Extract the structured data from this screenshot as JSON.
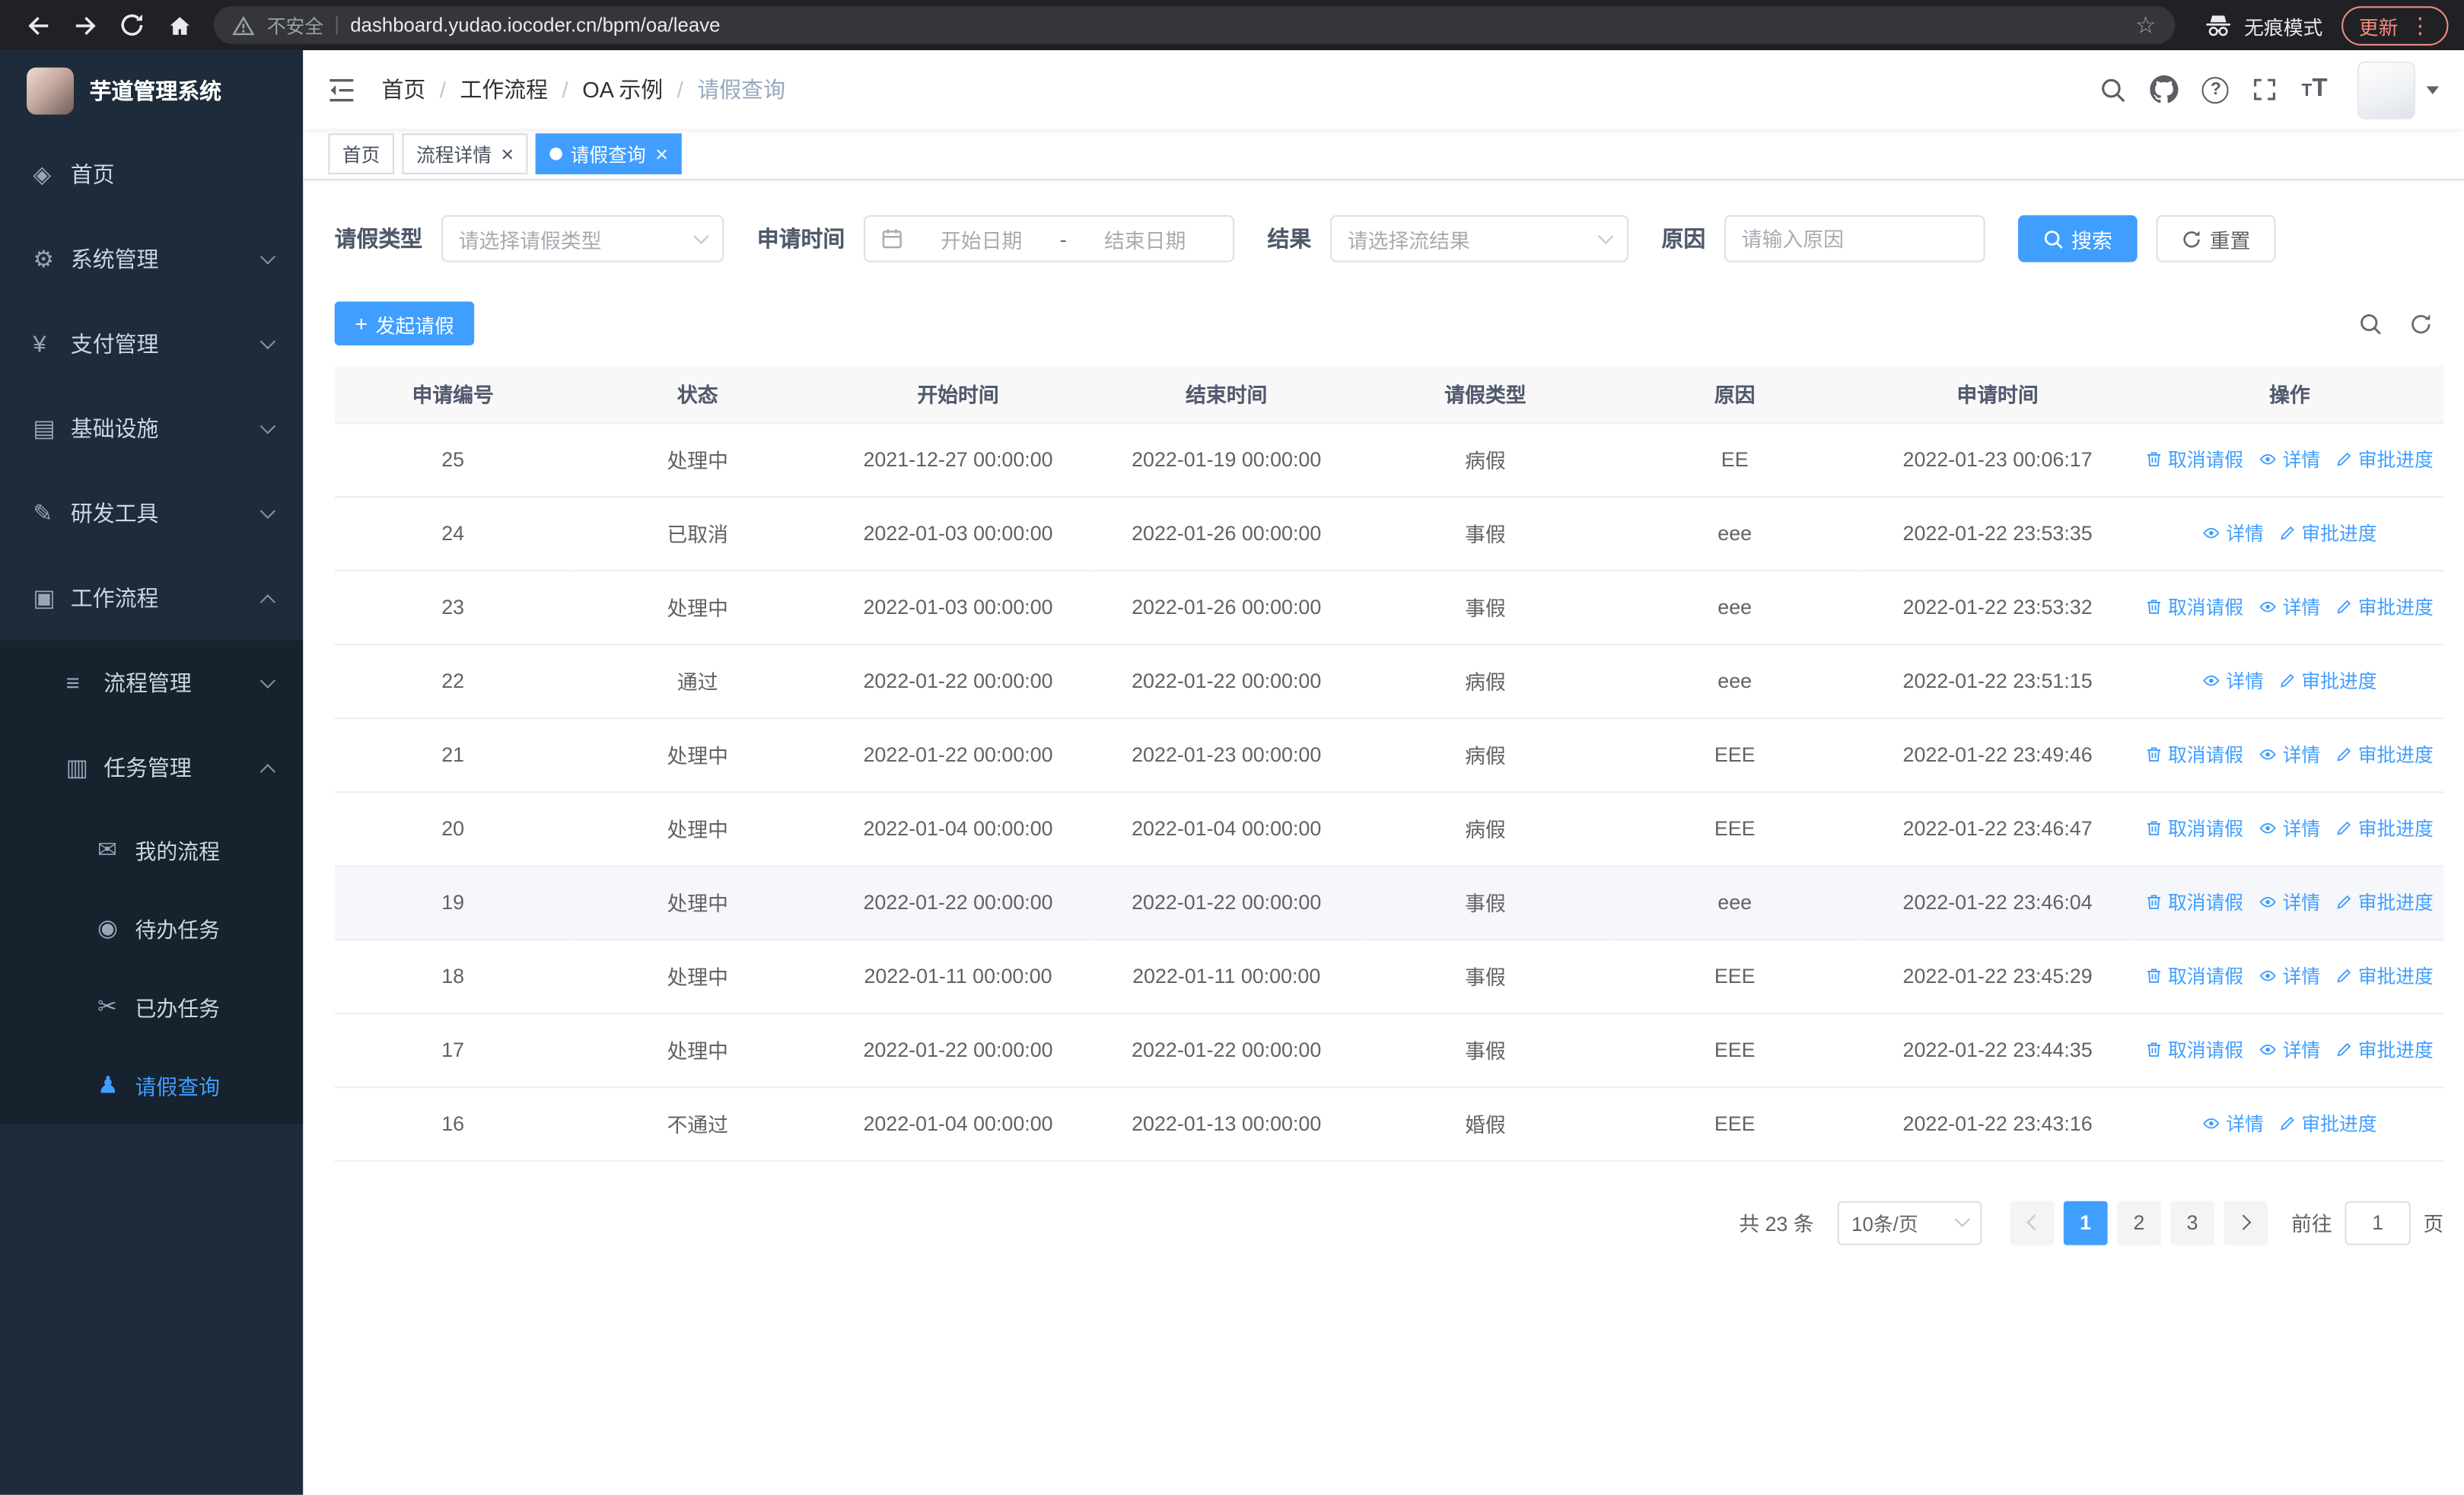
{
  "browser": {
    "security_label": "不安全",
    "url": "dashboard.yudao.iocoder.cn/bpm/oa/leave",
    "incognito_label": "无痕模式",
    "update_label": "更新"
  },
  "sidebar": {
    "logo_title": "芋道管理系统",
    "menu": [
      {
        "name": "home",
        "label": "首页",
        "icon": "home-icon",
        "level": 1,
        "chevron": "",
        "sub": false,
        "active": false
      },
      {
        "name": "system-management",
        "label": "系统管理",
        "icon": "gear-icon",
        "level": 1,
        "chevron": "down",
        "sub": false,
        "active": false
      },
      {
        "name": "payment-management",
        "label": "支付管理",
        "icon": "payment-icon",
        "level": 1,
        "chevron": "down",
        "sub": false,
        "active": false
      },
      {
        "name": "infrastructure",
        "label": "基础设施",
        "icon": "infrastructure-icon",
        "level": 1,
        "chevron": "down",
        "sub": false,
        "active": false
      },
      {
        "name": "devtools",
        "label": "研发工具",
        "icon": "devtools-icon",
        "level": 1,
        "chevron": "down",
        "sub": false,
        "active": false
      },
      {
        "name": "workflow",
        "label": "工作流程",
        "icon": "workflow-icon",
        "level": 1,
        "chevron": "up",
        "sub": false,
        "active": false
      },
      {
        "name": "process-management",
        "label": "流程管理",
        "icon": "process-icon",
        "level": 2,
        "chevron": "down",
        "sub": true,
        "active": false
      },
      {
        "name": "task-management",
        "label": "任务管理",
        "icon": "task-icon",
        "level": 2,
        "chevron": "up",
        "sub": true,
        "active": false
      },
      {
        "name": "my-process",
        "label": "我的流程",
        "icon": "my-process-icon",
        "level": 3,
        "chevron": "",
        "sub": true,
        "active": false
      },
      {
        "name": "todo-tasks",
        "label": "待办任务",
        "icon": "todo-icon",
        "level": 3,
        "chevron": "",
        "sub": true,
        "active": false
      },
      {
        "name": "done-tasks",
        "label": "已办任务",
        "icon": "done-icon",
        "level": 3,
        "chevron": "",
        "sub": true,
        "active": false
      },
      {
        "name": "leave-query",
        "label": "请假查询",
        "icon": "leave-query-icon",
        "level": 3,
        "chevron": "",
        "sub": true,
        "active": true
      }
    ]
  },
  "navbar": {
    "breadcrumb": [
      {
        "label": "首页",
        "current": false
      },
      {
        "label": "工作流程",
        "current": false
      },
      {
        "label": "OA 示例",
        "current": false
      },
      {
        "label": "请假查询",
        "current": true
      }
    ]
  },
  "tags": [
    {
      "name": "home",
      "label": "首页",
      "closable": false,
      "active": false
    },
    {
      "name": "process-detail",
      "label": "流程详情",
      "closable": true,
      "active": false
    },
    {
      "name": "leave-query",
      "label": "请假查询",
      "closable": true,
      "active": true
    }
  ],
  "filters": {
    "leave_type": {
      "label": "请假类型",
      "placeholder": "请选择请假类型"
    },
    "apply_time": {
      "label": "申请时间",
      "start_placeholder": "开始日期",
      "separator": "-",
      "end_placeholder": "结束日期"
    },
    "result": {
      "label": "结果",
      "placeholder": "请选择流结果"
    },
    "reason": {
      "label": "原因",
      "placeholder": "请输入原因"
    },
    "search_label": "搜索",
    "reset_label": "重置"
  },
  "toolbar": {
    "create_label": "发起请假"
  },
  "table": {
    "columns": [
      "申请编号",
      "状态",
      "开始时间",
      "结束时间",
      "请假类型",
      "原因",
      "申请时间",
      "操作"
    ],
    "action_labels": {
      "cancel": "取消请假",
      "detail": "详情",
      "progress": "审批进度"
    },
    "rows": [
      {
        "id": "25",
        "status": "处理中",
        "start_time": "2021-12-27 00:00:00",
        "end_time": "2022-01-19 00:00:00",
        "leave_type": "病假",
        "reason": "EE",
        "apply_time": "2022-01-23 00:06:17",
        "cancelable": true,
        "highlight": false
      },
      {
        "id": "24",
        "status": "已取消",
        "start_time": "2022-01-03 00:00:00",
        "end_time": "2022-01-26 00:00:00",
        "leave_type": "事假",
        "reason": "eee",
        "apply_time": "2022-01-22 23:53:35",
        "cancelable": false,
        "highlight": false
      },
      {
        "id": "23",
        "status": "处理中",
        "start_time": "2022-01-03 00:00:00",
        "end_time": "2022-01-26 00:00:00",
        "leave_type": "事假",
        "reason": "eee",
        "apply_time": "2022-01-22 23:53:32",
        "cancelable": true,
        "highlight": false
      },
      {
        "id": "22",
        "status": "通过",
        "start_time": "2022-01-22 00:00:00",
        "end_time": "2022-01-22 00:00:00",
        "leave_type": "病假",
        "reason": "eee",
        "apply_time": "2022-01-22 23:51:15",
        "cancelable": false,
        "highlight": false
      },
      {
        "id": "21",
        "status": "处理中",
        "start_time": "2022-01-22 00:00:00",
        "end_time": "2022-01-23 00:00:00",
        "leave_type": "病假",
        "reason": "EEE",
        "apply_time": "2022-01-22 23:49:46",
        "cancelable": true,
        "highlight": false
      },
      {
        "id": "20",
        "status": "处理中",
        "start_time": "2022-01-04 00:00:00",
        "end_time": "2022-01-04 00:00:00",
        "leave_type": "病假",
        "reason": "EEE",
        "apply_time": "2022-01-22 23:46:47",
        "cancelable": true,
        "highlight": false
      },
      {
        "id": "19",
        "status": "处理中",
        "start_time": "2022-01-22 00:00:00",
        "end_time": "2022-01-22 00:00:00",
        "leave_type": "事假",
        "reason": "eee",
        "apply_time": "2022-01-22 23:46:04",
        "cancelable": true,
        "highlight": true
      },
      {
        "id": "18",
        "status": "处理中",
        "start_time": "2022-01-11 00:00:00",
        "end_time": "2022-01-11 00:00:00",
        "leave_type": "事假",
        "reason": "EEE",
        "apply_time": "2022-01-22 23:45:29",
        "cancelable": true,
        "highlight": false
      },
      {
        "id": "17",
        "status": "处理中",
        "start_time": "2022-01-22 00:00:00",
        "end_time": "2022-01-22 00:00:00",
        "leave_type": "事假",
        "reason": "EEE",
        "apply_time": "2022-01-22 23:44:35",
        "cancelable": true,
        "highlight": false
      },
      {
        "id": "16",
        "status": "不通过",
        "start_time": "2022-01-04 00:00:00",
        "end_time": "2022-01-13 00:00:00",
        "leave_type": "婚假",
        "reason": "EEE",
        "apply_time": "2022-01-22 23:43:16",
        "cancelable": false,
        "highlight": false
      }
    ]
  },
  "pagination": {
    "total_text": "共 23 条",
    "page_size": "10条/页",
    "pages": [
      "1",
      "2",
      "3"
    ],
    "active_page": "1",
    "goto_label": "前往",
    "goto_value": "1",
    "goto_unit": "页"
  },
  "colors": {
    "primary": "#409eff",
    "sidebar_bg": "#1d2b3a",
    "sidebar_sub_bg": "#16222e",
    "update_accent": "#f28b82"
  }
}
